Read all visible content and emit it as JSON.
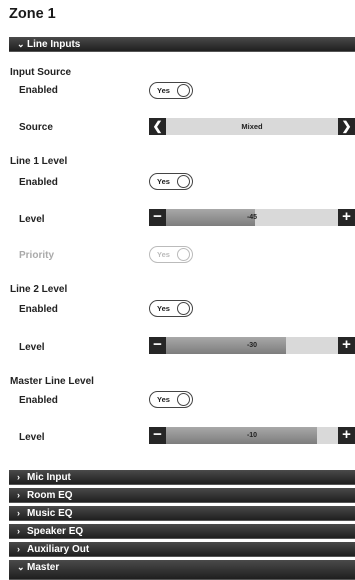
{
  "zone_title": "Zone 1",
  "line_inputs": {
    "header": "Line Inputs",
    "input_source": {
      "title": "Input Source",
      "enabled_label": "Enabled",
      "enabled_value": "Yes",
      "source_label": "Source",
      "source_value": "Mixed"
    },
    "line1": {
      "title": "Line 1 Level",
      "enabled_label": "Enabled",
      "enabled_value": "Yes",
      "level_label": "Level",
      "level_value": "-45",
      "level_fill_pct": 52,
      "priority_label": "Priority",
      "priority_value": "Yes"
    },
    "line2": {
      "title": "Line 2 Level",
      "enabled_label": "Enabled",
      "enabled_value": "Yes",
      "level_label": "Level",
      "level_value": "-30",
      "level_fill_pct": 70
    },
    "master": {
      "title": "Master Line Level",
      "enabled_label": "Enabled",
      "enabled_value": "Yes",
      "level_label": "Level",
      "level_value": "-10",
      "level_fill_pct": 88
    }
  },
  "sections": [
    {
      "label": "Mic Input",
      "expanded": false
    },
    {
      "label": "Room EQ",
      "expanded": false
    },
    {
      "label": "Music EQ",
      "expanded": false
    },
    {
      "label": "Speaker EQ",
      "expanded": false
    },
    {
      "label": "Auxiliary Out",
      "expanded": false
    },
    {
      "label": "Master",
      "expanded": true
    }
  ],
  "icons": {
    "collapsed": "chevron-right-icon",
    "expanded": "chevron-down-icon",
    "prev": "chevron-left-icon",
    "next": "chevron-right-icon",
    "minus": "minus-icon",
    "plus": "plus-icon"
  }
}
